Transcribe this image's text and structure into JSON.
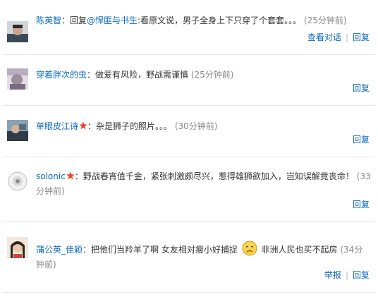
{
  "comments": [
    {
      "username": "陈英智",
      "text_prefix": "：回复",
      "mention": "@悍匪与书生",
      "text": ":看原文说，男子全身上下只穿了个套套。。。",
      "time": "(25分钟前)",
      "actions": [
        "查看对话",
        "回复"
      ]
    },
    {
      "username": "穿着胖次的虫",
      "text": "：做爱有风险，野战需谨慎",
      "time": "(25分钟前)",
      "actions": [
        "回复"
      ]
    },
    {
      "username": "单眼皮江诗",
      "text": "：杂是狮子的照片。。。",
      "time": "(30分钟前)",
      "actions": [
        "回复"
      ]
    },
    {
      "username": "solonic",
      "text": "：野战春宵值千金，紧张刺激颇尽兴，惹得雄狮欲加入，岂知误解竟丧命！",
      "time": "(33分钟前)",
      "actions": [
        "回复"
      ]
    },
    {
      "username": "蒲公英_佳颖",
      "text": "：把他们当羚羊了啊 女友相对瘦小好捕捉",
      "text_after": "非洲人民也买不起房",
      "time": "(34分钟前)",
      "actions": [
        "举报",
        "回复"
      ]
    }
  ],
  "icons": {
    "vip_star": "star-badge-icon",
    "emoji": "sad-face-emoji"
  },
  "colors": {
    "link": "#0a6ac0",
    "time": "#888888",
    "text": "#333333",
    "star": "#e8462f"
  }
}
